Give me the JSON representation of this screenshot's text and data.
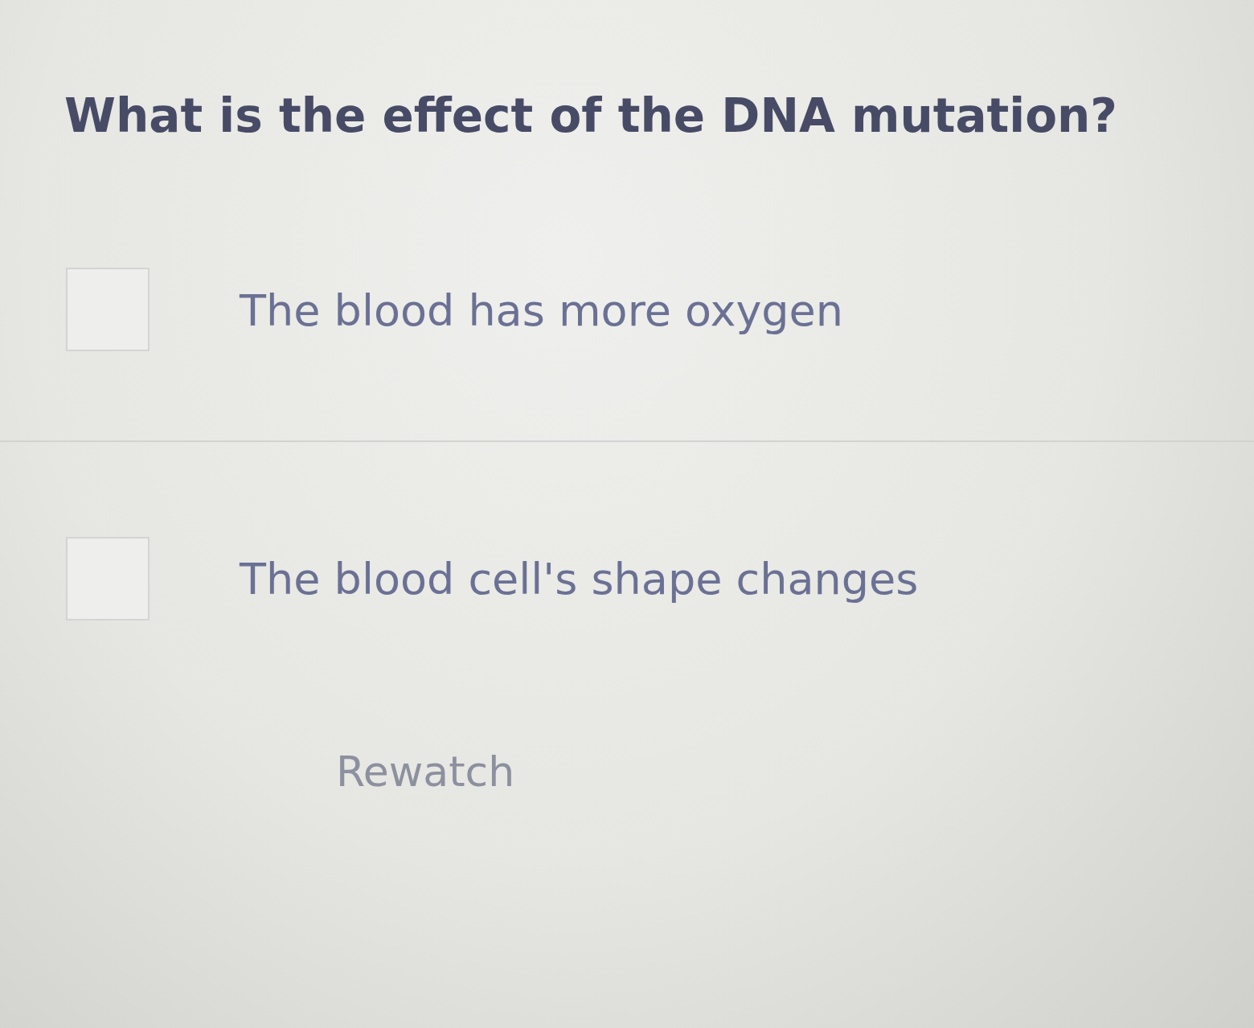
{
  "question": "What is the effect of the DNA mutation?",
  "options": [
    {
      "label": "The blood has more oxygen",
      "checked": false
    },
    {
      "label": "The blood cell's shape changes",
      "checked": false
    }
  ],
  "link": "Rewatch"
}
